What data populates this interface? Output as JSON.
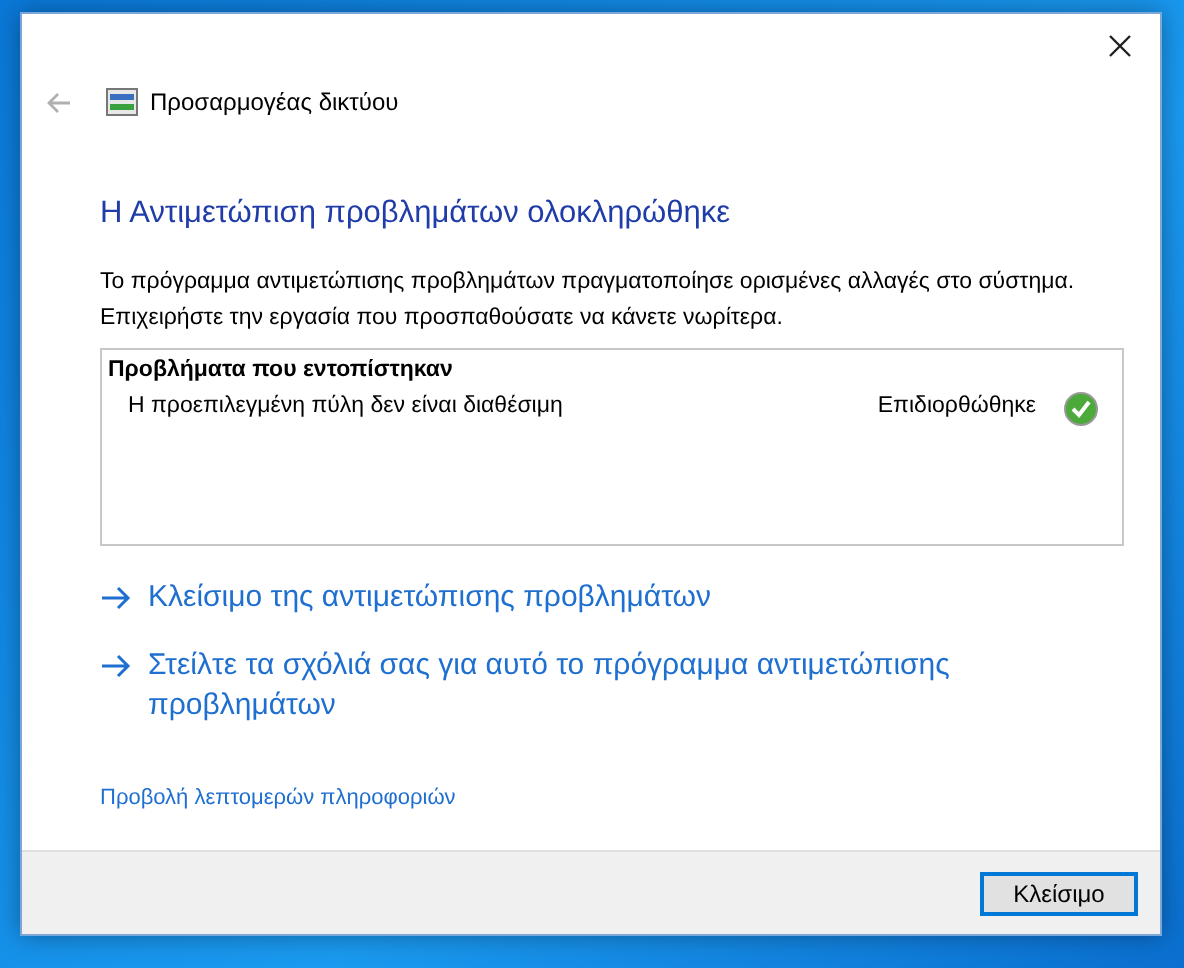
{
  "window": {
    "title": "Προσαρμογέας δικτύου"
  },
  "heading": "Η Αντιμετώπιση προβλημάτων ολοκληρώθηκε",
  "description": "Το πρόγραμμα αντιμετώπισης προβλημάτων πραγματοποίησε ορισμένες αλλαγές στο σύστημα. Επιχειρήστε την εργασία που προσπαθούσατε να κάνετε νωρίτερα.",
  "problems": {
    "title": "Προβλήματα που εντοπίστηκαν",
    "items": [
      {
        "name": "Η προεπιλεγμένη πύλη δεν είναι διαθέσιμη",
        "status": "Επιδιορθώθηκε",
        "fixed": true
      }
    ]
  },
  "actions": [
    {
      "label": "Κλείσιμο της αντιμετώπισης προβλημάτων"
    },
    {
      "label": "Στείλτε τα σχόλιά σας για αυτό το πρόγραμμα αντιμετώπισης προβλημάτων"
    }
  ],
  "details_link": "Προβολή λεπτομερών πληροφοριών",
  "footer": {
    "button": "Κλείσιμο"
  }
}
